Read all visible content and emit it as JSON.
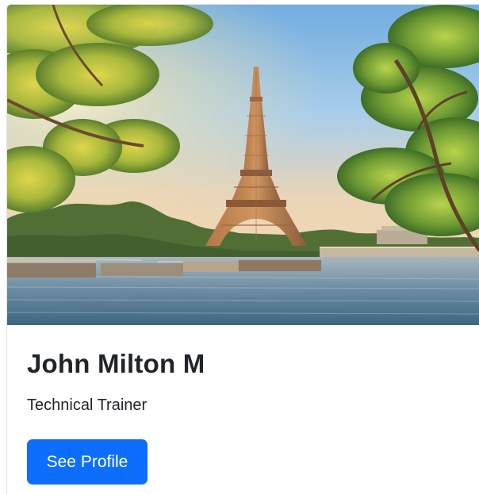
{
  "profile_card": {
    "name": "John Milton M",
    "role": "Technical Trainer",
    "button_label": "See Profile",
    "image": "Eiffel Tower at sunrise over the Seine",
    "colors": {
      "primary_button": "#0d6efd",
      "text": "#212529",
      "sky_top": "#7eb7e7",
      "water": "#6d8fa6"
    }
  }
}
